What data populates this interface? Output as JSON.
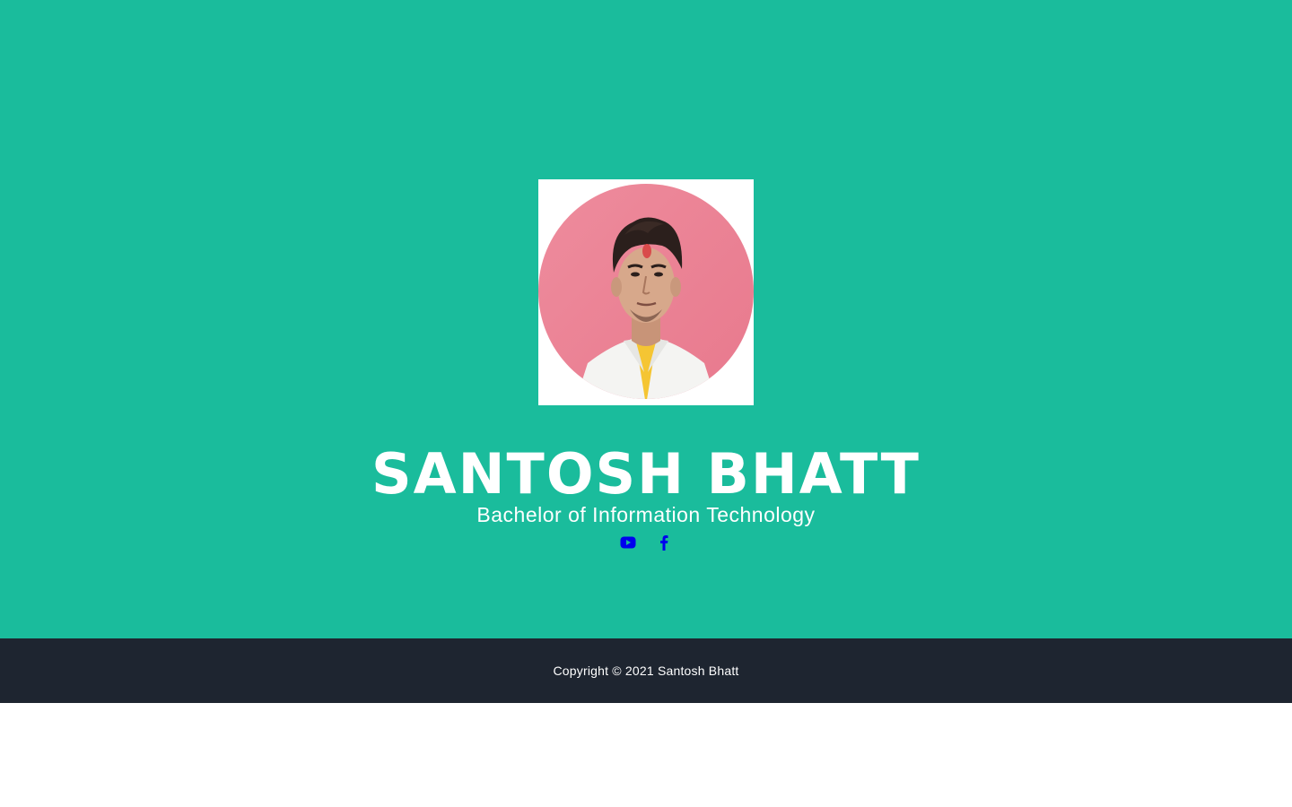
{
  "colors": {
    "primary": "#1ABC9C",
    "footer_bg": "#1E2530",
    "icon": "#0000EE",
    "text_on_primary": "#FFFFFF"
  },
  "profile": {
    "name": "SANTOSH BHATT",
    "subtitle": "Bachelor of Information Technology",
    "avatar": "profile-photo"
  },
  "social": [
    {
      "icon": "youtube-icon"
    },
    {
      "icon": "facebook-icon"
    }
  ],
  "footer": {
    "copyright": "Copyright © 2021 Santosh Bhatt"
  }
}
